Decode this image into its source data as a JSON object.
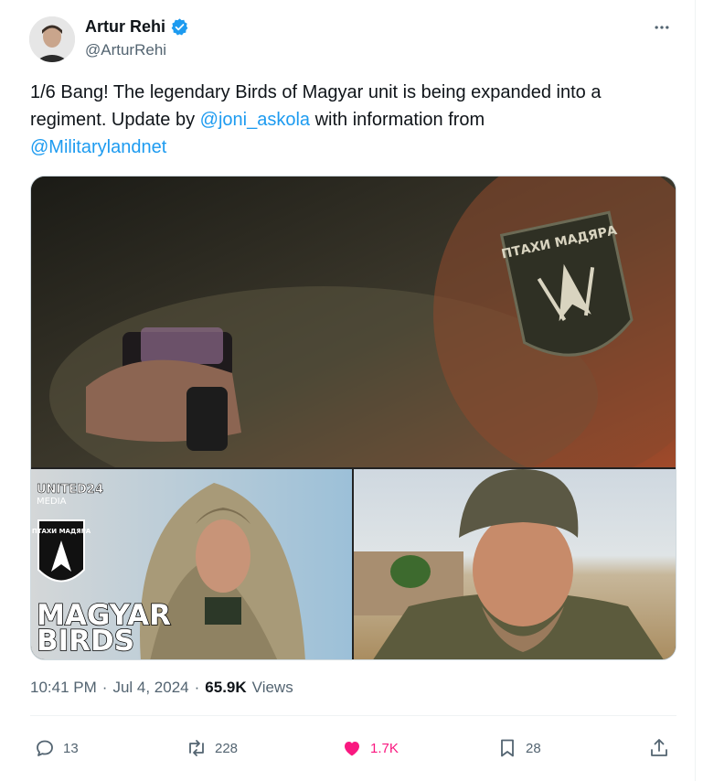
{
  "author": {
    "name": "Artur Rehi",
    "handle": "@ArturRehi",
    "verified_icon": "verified-badge-icon"
  },
  "menu_icon": "more-horizontal-icon",
  "tweet": {
    "text_before": "1/6 Bang! The legendary Birds of Magyar unit is being expanded into a regiment. Update by ",
    "mention1": "@joni_askola",
    "text_middle": " with information from ",
    "mention2": "@Militarylandnet"
  },
  "media": {
    "photo2_overlay": {
      "brand_line1": "UNITED24",
      "brand_line2": "MEDIA",
      "patch_text": "ПТАХИ МАДЯРА",
      "title_line1": "MAGYAR",
      "title_line2": "BIRDS"
    },
    "photo1_patch_text": "ПТАХИ МАДЯРА"
  },
  "meta": {
    "time": "10:41 PM",
    "sep1": "·",
    "date": "Jul 4, 2024",
    "sep2": "·",
    "views_count": "65.9K",
    "views_label": "Views"
  },
  "actions": {
    "replies": "13",
    "retweets": "228",
    "likes": "1.7K",
    "bookmarks": "28"
  },
  "colors": {
    "accent": "#1d9bf0",
    "like": "#f91880",
    "secondary_text": "#536471"
  }
}
